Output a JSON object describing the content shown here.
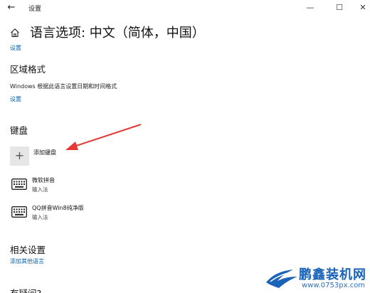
{
  "window": {
    "title": "设置",
    "back_glyph": "←",
    "minimize_glyph": "—",
    "maximize_glyph": "☐",
    "close_glyph": "✕"
  },
  "page": {
    "title": "语言选项: 中文（简体，中国）",
    "breadcrumb": "设置"
  },
  "region": {
    "heading": "区域格式",
    "description": "Windows 根据此语言设置日期和时间格式",
    "link": "设置"
  },
  "keyboard": {
    "heading": "键盘",
    "add_label": "添加键盘",
    "add_glyph": "+",
    "items": [
      {
        "name": "微软拼音",
        "sub": "输入法",
        "icon": "keyboard-icon"
      },
      {
        "name": "QQ拼音Win8纯净版",
        "sub": "输入法",
        "icon": "keyboard-icon"
      }
    ]
  },
  "related": {
    "heading": "相关设置",
    "link": "添加其他语言"
  },
  "more": {
    "heading": "有疑问?"
  },
  "watermark": {
    "brand": "鹏鑫装机网",
    "url": "www.0753px.com"
  },
  "colors": {
    "link": "#0063b1",
    "arrow": "#e53935",
    "add_box": "#e6e6e6",
    "watermark": "#1a63b8"
  }
}
